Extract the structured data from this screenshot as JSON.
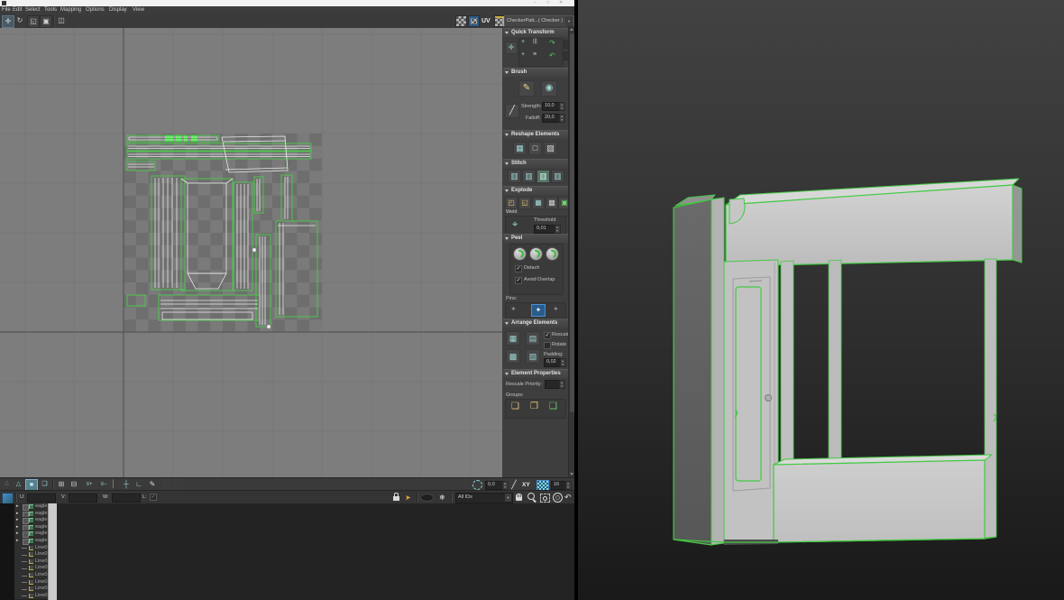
{
  "window_controls": {
    "minimize": "–",
    "maximize": "□",
    "close": "✕"
  },
  "menu": {
    "items": [
      "File",
      "Edit",
      "Select",
      "Tools",
      "Mapping",
      "Options",
      "Display",
      "View"
    ]
  },
  "top_toolbar": {
    "uv_label": "UV",
    "texture_dropdown": "CheckerPatt...( Checker )"
  },
  "panel": {
    "quick_transform": {
      "title": "Quick Transform"
    },
    "brush": {
      "title": "Brush",
      "strength_label": "Strength:",
      "strength_value": "10,0",
      "falloff_label": "Falloff:",
      "falloff_value": "20,0"
    },
    "reshape": {
      "title": "Reshape Elements"
    },
    "stitch": {
      "title": "Stitch"
    },
    "explode": {
      "title": "Explode",
      "weld_label": "Weld",
      "threshold_label": "Threshold",
      "threshold_value": "0,01"
    },
    "peel": {
      "title": "Peel",
      "detach_label": "Detach",
      "avoid_label": "Avoid Overlap",
      "pins_label": "Pins:"
    },
    "arrange": {
      "title": "Arrange Elements",
      "rescale_label": "Rescale",
      "rotate_label": "Rotate",
      "padding_label": "Padding:",
      "padding_value": "0,02"
    },
    "element_properties": {
      "title": "Element Properties",
      "rescale_priority_label": "Rescale Priority:",
      "rescale_priority_value": "",
      "groups_label": "Groups:"
    }
  },
  "tool_row": {
    "soft_sel_value": "0,0",
    "axis_label": "XY",
    "grid_value": "16"
  },
  "status_row": {
    "u_label": "U:",
    "u_value": "",
    "v_label": "V:",
    "v_value": "",
    "w_label": "W:",
    "w_value": "",
    "l_label": "L:",
    "ids_value": "All IDs"
  },
  "explorer": {
    "rows": [
      {
        "label": "eagle"
      },
      {
        "label": "eagle"
      },
      {
        "label": "eagle"
      },
      {
        "label": "eagle"
      },
      {
        "label": "eagle"
      },
      {
        "label": "eagle"
      },
      {
        "label": "Line0"
      },
      {
        "label": "Line0"
      },
      {
        "label": "Line0"
      },
      {
        "label": "Line0"
      },
      {
        "label": "Line0"
      },
      {
        "label": "Line0"
      },
      {
        "label": "Line0"
      },
      {
        "label": "Line0"
      }
    ]
  },
  "check": "✓",
  "colors": {
    "selection_green": "#43c943",
    "teal_icon": "#9fd6d6",
    "active_blue": "#2a5b8c"
  },
  "icons": {
    "move": "✛",
    "rotate": "↻",
    "scale": "◱",
    "freeform": "▣",
    "mirror": "◫",
    "qt_cross": "✛",
    "plus": "+",
    "bars": "|||",
    "lines": "≡",
    "cw": "↷",
    "ccw": "↶",
    "brush_paint": "✎",
    "brush_relax": "◉",
    "line_tool": "╱",
    "reshape1": "▦",
    "reshape2": "□",
    "reshape3": "▨",
    "stitch": "▥",
    "explode1": "◰",
    "explode2": "◱",
    "explode3": "▦",
    "explode4": "▩",
    "explode5": "▣",
    "weld": "⌖",
    "pin": "✦",
    "arrange1": "▦",
    "arrange2": "▤",
    "arrange3": "▩",
    "arrange4": "▧",
    "group1": "❏",
    "group2": "❐",
    "group3": "❑",
    "vertex": "∴",
    "edge": "△",
    "poly": "■",
    "element": "❑",
    "grow": "⊞",
    "shrink": "⊟",
    "loop": "≡+",
    "ring": "≡−",
    "bar": "▏",
    "align_x": "┼",
    "align_y": "∟",
    "pencil": "✎",
    "curve": "╱",
    "undo": "↶",
    "filter": "➤",
    "snowflake": "❄",
    "dropdown_arrow": "▼",
    "row_arrow": "▸"
  }
}
